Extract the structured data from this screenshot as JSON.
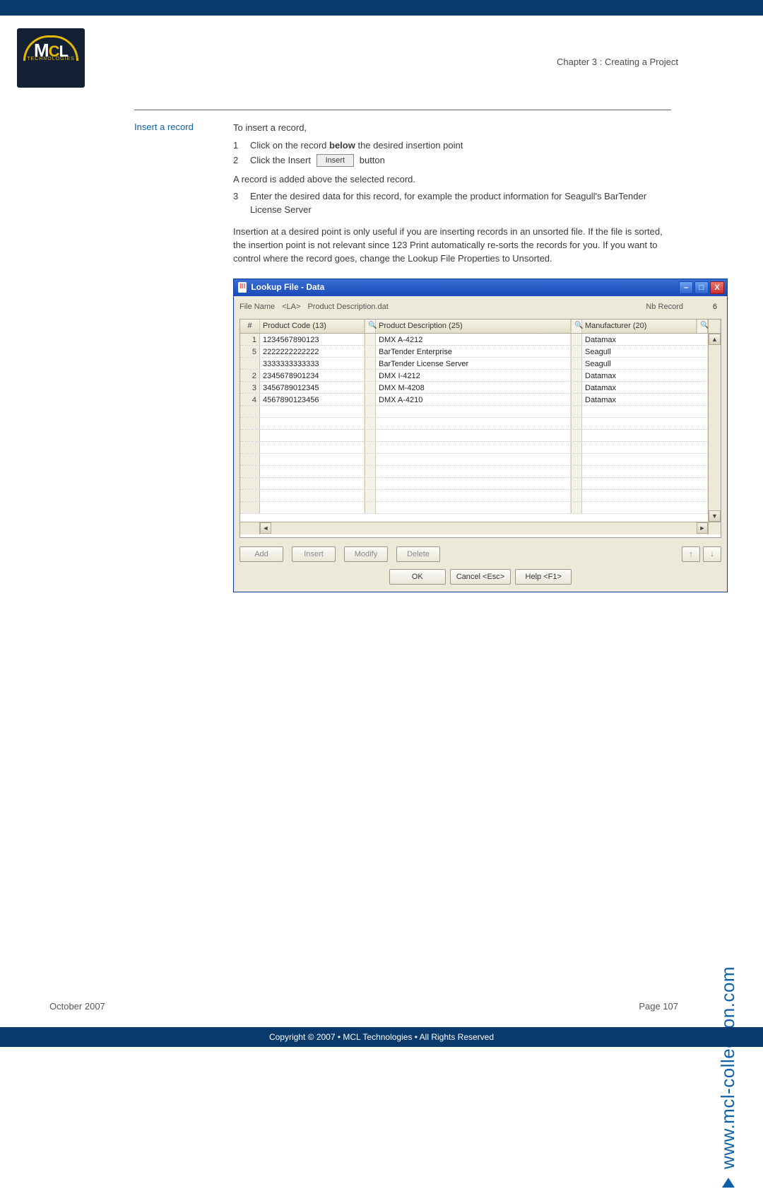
{
  "header": {
    "chapter": "Chapter 3 : Creating a Project"
  },
  "section": {
    "label": "Insert a record",
    "intro": "To insert a record,",
    "step1_num": "1",
    "step1_a": "Click on the record ",
    "step1_bold": "below",
    "step1_b": " the desired insertion point",
    "step2_num": "2",
    "step2_a": "Click the Insert ",
    "step2_btn": "Insert",
    "step2_b": " button",
    "added": "A record is added above the selected record.",
    "step3_num": "3",
    "step3": "Enter the desired data for this record, for example the product information for Seagull's BarTender License Server",
    "note": "Insertion at a desired point is only useful if you are inserting records in an unsorted file. If the file is sorted, the insertion point is not relevant since 123 Print automatically re-sorts the records for you. If you want to control where the record goes, change the Lookup File Properties to Unsorted."
  },
  "dialog": {
    "title": "Lookup File - Data",
    "file_name_label": "File Name",
    "file_name_code": "<LA>",
    "file_name_value": "Product Description.dat",
    "nb_record_label": "Nb Record",
    "nb_record_value": "6",
    "columns": {
      "idx": "#",
      "code": "Product Code (13)",
      "desc": "Product Description (25)",
      "man": "Manufacturer (20)"
    },
    "rows": [
      {
        "idx": "1",
        "code": "1234567890123",
        "desc": "DMX A-4212",
        "man": "Datamax"
      },
      {
        "idx": "5",
        "code": "2222222222222",
        "desc": "BarTender Enterprise",
        "man": "Seagull"
      },
      {
        "idx": "",
        "code": "3333333333333",
        "desc": "BarTender License Server",
        "man": "Seagull"
      },
      {
        "idx": "2",
        "code": "2345678901234",
        "desc": "DMX I-4212",
        "man": "Datamax"
      },
      {
        "idx": "3",
        "code": "3456789012345",
        "desc": "DMX M-4208",
        "man": "Datamax"
      },
      {
        "idx": "4",
        "code": "4567890123456",
        "desc": "DMX A-4210",
        "man": "Datamax"
      }
    ],
    "buttons": {
      "add": "Add",
      "insert": "Insert",
      "modify": "Modify",
      "delete": "Delete",
      "up": "↑",
      "down": "↓",
      "ok": "OK",
      "cancel": "Cancel <Esc>",
      "help": "Help <F1>"
    },
    "win": {
      "min": "–",
      "max": "□",
      "close": "X"
    }
  },
  "side_url": "www.mcl-collection.com",
  "footer": {
    "date": "October 2007",
    "page": "Page 107",
    "copyright": "Copyright © 2007 • MCL Technologies • All Rights Reserved"
  }
}
